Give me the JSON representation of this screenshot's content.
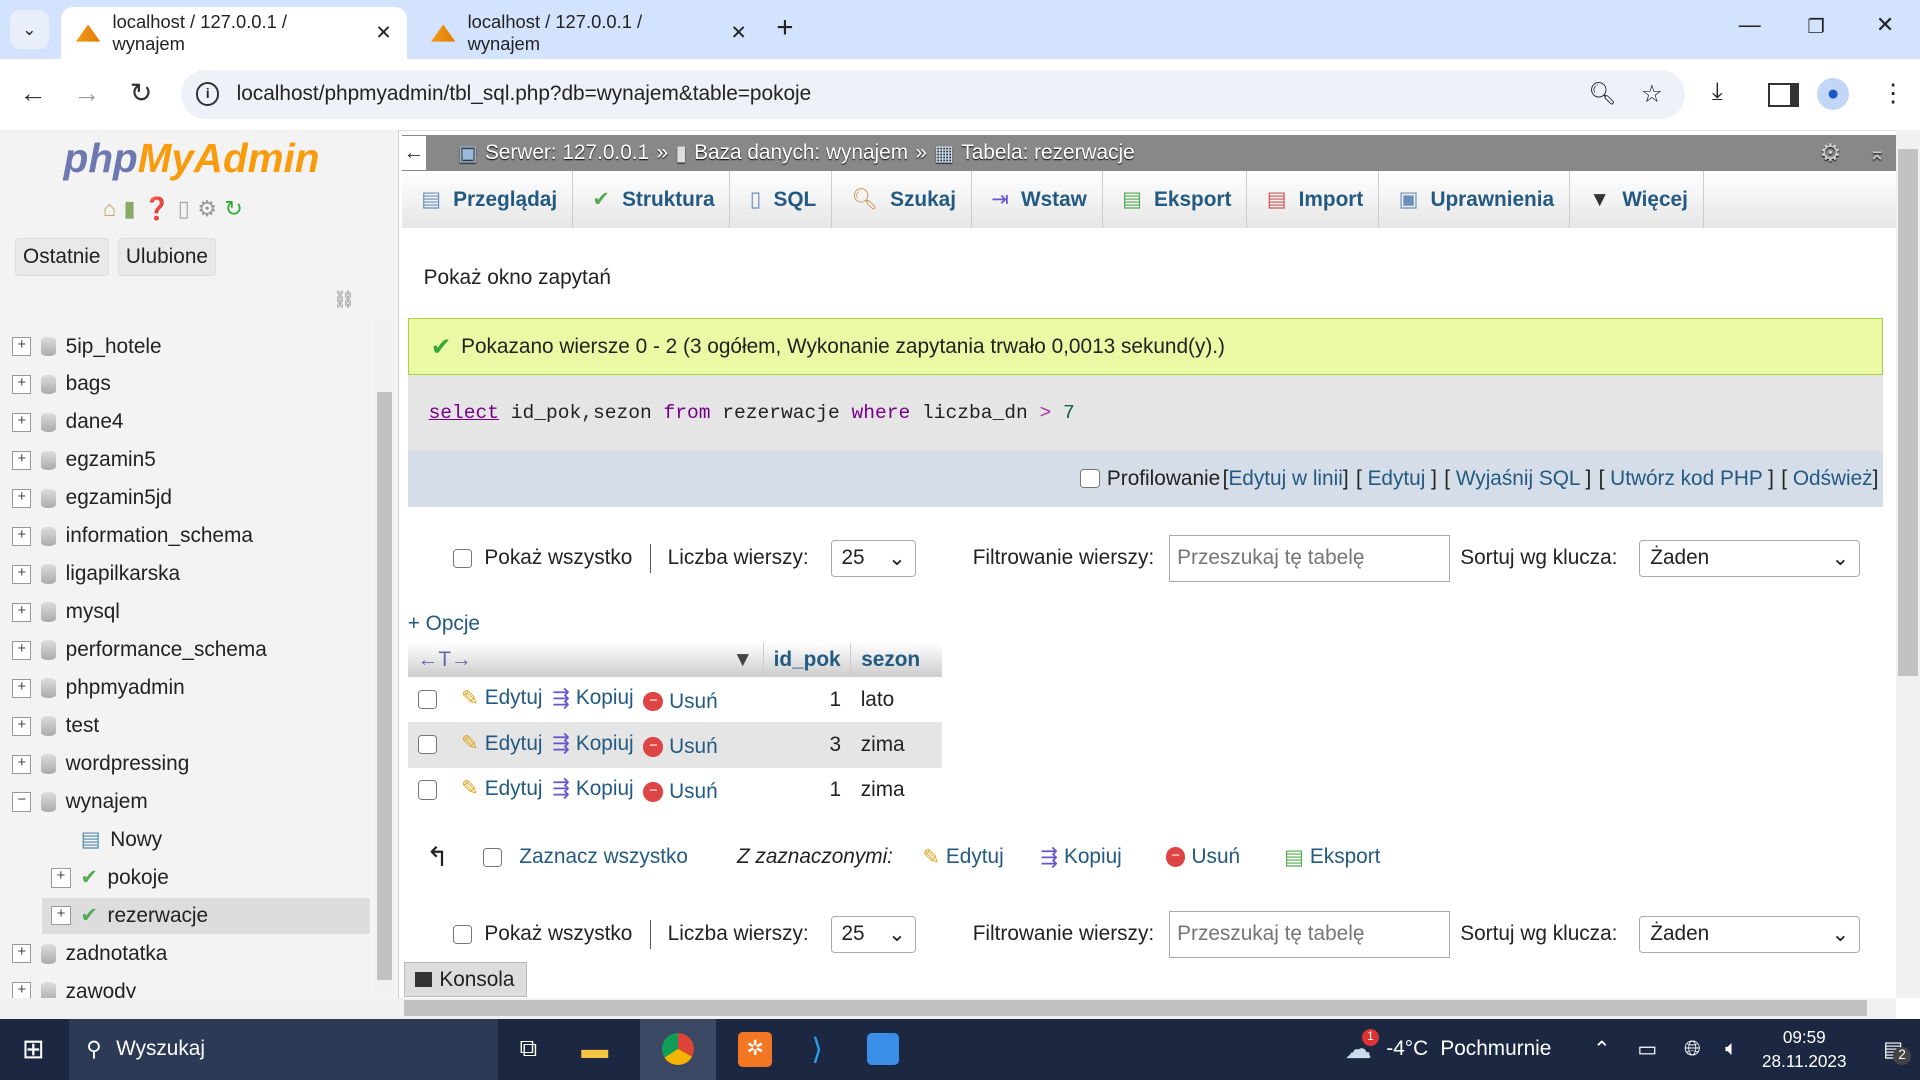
{
  "browser": {
    "tabs": [
      {
        "title": "localhost / 127.0.0.1 / wynajem",
        "active": true
      },
      {
        "title": "localhost / 127.0.0.1 / wynajem",
        "active": false
      }
    ],
    "url": "localhost/phpmyadmin/tbl_sql.php?db=wynajem&table=pokoje"
  },
  "sidebar": {
    "logo_php": "php",
    "logo_my": "MyAdmin",
    "recent": "Ostatnie",
    "favorites": "Ulubione",
    "databases": [
      {
        "name": "5ip_hotele",
        "exp": "+"
      },
      {
        "name": "bags",
        "exp": "+"
      },
      {
        "name": "dane4",
        "exp": "+"
      },
      {
        "name": "egzamin5",
        "exp": "+"
      },
      {
        "name": "egzamin5jd",
        "exp": "+"
      },
      {
        "name": "information_schema",
        "exp": "+"
      },
      {
        "name": "ligapilkarska",
        "exp": "+"
      },
      {
        "name": "mysql",
        "exp": "+"
      },
      {
        "name": "performance_schema",
        "exp": "+"
      },
      {
        "name": "phpmyadmin",
        "exp": "+"
      },
      {
        "name": "test",
        "exp": "+"
      },
      {
        "name": "wordpressing",
        "exp": "+"
      },
      {
        "name": "wynajem",
        "exp": "−"
      }
    ],
    "wynajem_children": [
      {
        "name": "Nowy"
      },
      {
        "name": "pokoje"
      },
      {
        "name": "rezerwacje"
      }
    ],
    "after": [
      {
        "name": "zadnotatka"
      },
      {
        "name": "zawody"
      }
    ]
  },
  "breadcrumb": {
    "server": "Serwer: 127.0.0.1",
    "database": "Baza danych: wynajem",
    "table": "Tabela: rezerwacje",
    "sep": "»"
  },
  "tabs": [
    "Przeglądaj",
    "Struktura",
    "SQL",
    "Szukaj",
    "Wstaw",
    "Eksport",
    "Import",
    "Uprawnienia",
    "Więcej"
  ],
  "main": {
    "show_query": "Pokaż okno zapytań",
    "success": "Pokazano wiersze 0 - 2 (3 ogółem, Wykonanie zapytania trwało 0,0013 sekund(y).)",
    "sql": {
      "kw1": "select",
      "cols": " id_pok,sezon ",
      "kw2": "from",
      "tbl": " rezerwacje ",
      "kw3": "where",
      "cond": " liczba_dn ",
      "op": ">",
      "val": " 7"
    },
    "profiling": "Profilowanie",
    "links": [
      "Edytuj w linii",
      "Edytuj",
      "Wyjaśnij SQL",
      "Utwórz kod PHP",
      "Odśwież"
    ],
    "show_all": "Pokaż wszystko",
    "rows_label": "Liczba wierszy:",
    "rows_value": "25",
    "filter_label": "Filtrowanie wierszy:",
    "filter_placeholder": "Przeszukaj tę tabelę",
    "sort_label": "Sortuj wg klucza:",
    "sort_value": "Żaden",
    "options": "+ Opcje",
    "columns": [
      "id_pok",
      "sezon"
    ],
    "actions": {
      "edit": "Edytuj",
      "copy": "Kopiuj",
      "delete": "Usuń"
    },
    "rows": [
      {
        "id_pok": "1",
        "sezon": "lato"
      },
      {
        "id_pok": "3",
        "sezon": "zima"
      },
      {
        "id_pok": "1",
        "sezon": "zima"
      }
    ],
    "select_all": "Zaznacz wszystko",
    "with_selected": "Z zaznaczonymi:",
    "export": "Eksport",
    "console": "Konsola"
  },
  "taskbar": {
    "search": "Wyszukaj",
    "weather_temp": "-4°C",
    "weather_desc": "Pochmurnie",
    "weather_badge": "1",
    "time": "09:59",
    "date": "28.11.2023",
    "notif_count": "2"
  }
}
